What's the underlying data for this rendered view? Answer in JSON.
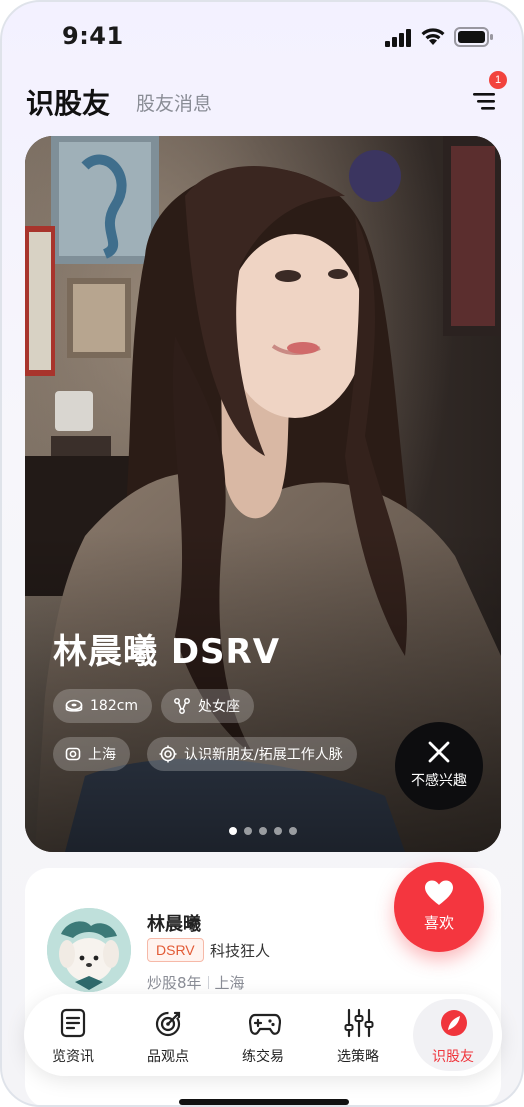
{
  "status_bar": {
    "time": "9:41"
  },
  "header": {
    "title": "识股友",
    "subtitle": "股友消息",
    "notification_count": "1"
  },
  "profile": {
    "display_name": "林晨曦 DSRV",
    "chips": {
      "height": "182cm",
      "zodiac": "处女座",
      "location": "上海",
      "purpose": "认识新朋友/拓展工作人脉"
    },
    "dislike_label": "不感兴趣",
    "like_label": "喜欢",
    "photo_pages": 5,
    "current_page": 1
  },
  "info_card": {
    "name": "林晨曦",
    "tag": "DSRV",
    "title": "科技狂人",
    "experience": "炒股8年",
    "city": "上海"
  },
  "tabs": [
    {
      "label": "览资讯",
      "icon": "news-icon"
    },
    {
      "label": "品观点",
      "icon": "target-icon"
    },
    {
      "label": "练交易",
      "icon": "gamepad-icon"
    },
    {
      "label": "选策略",
      "icon": "sliders-icon"
    },
    {
      "label": "识股友",
      "icon": "compass-icon",
      "active": true
    }
  ],
  "colors": {
    "accent": "#f4363f",
    "active_tab": "#f0353c"
  }
}
